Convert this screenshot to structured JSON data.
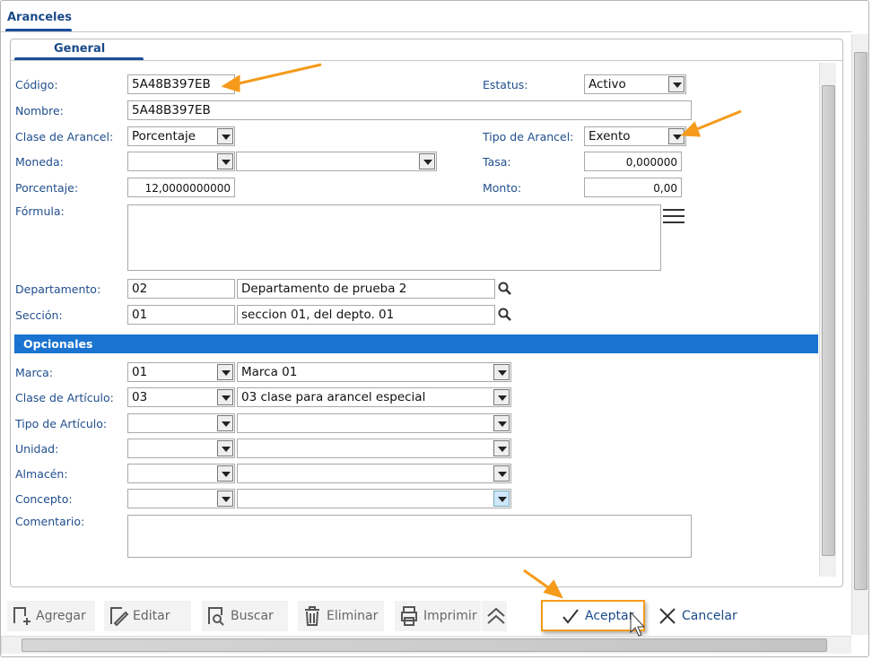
{
  "tabs": {
    "main": "Aranceles",
    "sub": "General"
  },
  "fields": {
    "codigo": {
      "label": "Código:",
      "value": "5A48B397EB"
    },
    "nombre": {
      "label": "Nombre:",
      "value": "5A48B397EB"
    },
    "estatus": {
      "label": "Estatus:",
      "value": "Activo"
    },
    "clase_arancel": {
      "label": "Clase de Arancel:",
      "value": "Porcentaje"
    },
    "tipo_arancel": {
      "label": "Tipo de Arancel:",
      "value": "Exento"
    },
    "moneda": {
      "label": "Moneda:",
      "value": "",
      "value2": ""
    },
    "tasa": {
      "label": "Tasa:",
      "value": "0,000000"
    },
    "porcentaje": {
      "label": "Porcentaje:",
      "value": "12,0000000000"
    },
    "monto": {
      "label": "Monto:",
      "value": "0,00"
    },
    "formula": {
      "label": "Fórmula:",
      "value": ""
    },
    "departamento": {
      "label": "Departamento:",
      "code": "02",
      "desc": "Departamento de prueba 2"
    },
    "seccion": {
      "label": "Sección:",
      "code": "01",
      "desc": "seccion 01, del depto. 01"
    }
  },
  "opcionales": {
    "title": "Opcionales",
    "rows": [
      {
        "label": "Marca:",
        "code": "01",
        "desc": "Marca 01"
      },
      {
        "label": "Clase de Artículo:",
        "code": "03",
        "desc": "03 clase para arancel especial"
      },
      {
        "label": "Tipo de Artículo:",
        "code": "",
        "desc": ""
      },
      {
        "label": "Unidad:",
        "code": "",
        "desc": ""
      },
      {
        "label": "Almacén:",
        "code": "",
        "desc": ""
      },
      {
        "label": "Concepto:",
        "code": "",
        "desc": ""
      }
    ],
    "comentario": {
      "label": "Comentario:",
      "value": ""
    }
  },
  "toolbar": {
    "agregar": "Agregar",
    "editar": "Editar",
    "buscar": "Buscar",
    "eliminar": "Eliminar",
    "imprimir": "Imprimir",
    "aceptar": "Aceptar",
    "cancelar": "Cancelar"
  },
  "colors": {
    "label": "#1f4e8c",
    "section": "#1a73d0",
    "annotation_arrow": "#f59a1b"
  }
}
